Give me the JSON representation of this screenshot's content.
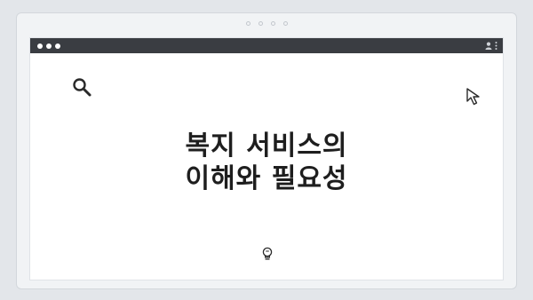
{
  "title_lines": [
    "복지 서비스의",
    "이해와 필요성"
  ],
  "icons": {
    "search": "search-icon",
    "cursor": "cursor-arrow-icon",
    "bulb": "lightbulb-icon",
    "user": "user-icon",
    "menu": "more-vertical-icon"
  },
  "colors": {
    "titlebar": "#3a3d42",
    "page_background": "#e3e6ea",
    "window_background": "#ffffff",
    "text": "#1e1e1e"
  }
}
